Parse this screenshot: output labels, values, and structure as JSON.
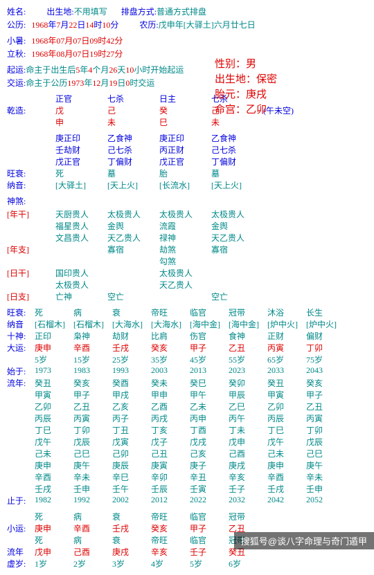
{
  "header": {
    "name_lbl": "姓名:",
    "birthplace_lbl": "出生地:",
    "birthplace": "不用填写",
    "paipan_lbl": "排盘方式:",
    "paipan": "普通方式排盘",
    "gongli_lbl": "公历:",
    "gongli_y": "1968",
    "gl_y": "年",
    "gongli_m": "7",
    "gl_m": "月",
    "gongli_d": "22",
    "gl_d": "日",
    "gongli_h": "14",
    "gl_h": "时",
    "gongli_min": "10",
    "gl_min": "分",
    "nongli_lbl": "农历:",
    "nongli": "戊申年[大驿土]六月廿七日"
  },
  "terms": {
    "xiaoshu_lbl": "小暑:",
    "xiaoshu": "1968年07月07日09时42分",
    "liqiu_lbl": "立秋:",
    "liqiu": "1968年08月07日19时27分"
  },
  "side": {
    "sex_lbl": "性别：",
    "sex": "男",
    "bp_lbl": "出生地：",
    "bp": "保密",
    "ty_lbl": "胎元：",
    "ty": "庚戌",
    "mg_lbl": "命宫：",
    "mg": "乙卯"
  },
  "qiyun": {
    "q_lbl": "起运:",
    "q_a": "命主于出生后",
    "q_y": "5",
    "q_yl": "年",
    "q_m": "4",
    "q_ml": "个月",
    "q_d": "26",
    "q_dl": "天",
    "q_h": "10",
    "q_hl": "小时开始起运",
    "j_lbl": "交运:",
    "j_a": "命主于公历",
    "j_y": "1973",
    "j_yl": "年",
    "j_m": "12",
    "j_ml": "月",
    "j_d": "19",
    "j_dl": "日",
    "j_h": "0",
    "j_hl": "时交运"
  },
  "qz": {
    "h1": [
      "正官",
      "七杀",
      "日主",
      "七杀"
    ],
    "lbl": "乾造:",
    "g": [
      "戊",
      "己",
      "癸",
      "己"
    ],
    "z": [
      "申",
      "未",
      "巳",
      "未"
    ],
    "kong": "(午未空)"
  },
  "canggan": [
    [
      "庚正印",
      "乙食神",
      "庚正印",
      "乙食神"
    ],
    [
      "壬劫财",
      "己七杀",
      "丙正财",
      "己七杀"
    ],
    [
      "戊正官",
      "丁偏财",
      "戊正官",
      "丁偏财"
    ]
  ],
  "wangshuai": {
    "lbl": "旺衰:",
    "v": [
      "死",
      "墓",
      "胎",
      "墓"
    ]
  },
  "nayin": {
    "lbl": "纳音:",
    "v": [
      "[大驿土]",
      "[天上火]",
      "[长流水]",
      "[天上火]"
    ]
  },
  "shensha": {
    "lbl": "神煞:",
    "ng_lbl": "[年干]",
    "ng": [
      [
        "天厨贵人",
        "太极贵人",
        "太极贵人",
        "太极贵人"
      ],
      [
        "福星贵人",
        "金舆",
        "流霞",
        "金舆"
      ],
      [
        "文昌贵人",
        "天乙贵人",
        "禄神",
        "天乙贵人"
      ]
    ],
    "nz_lbl": "[年支]",
    "nz": [
      [
        "",
        "寡宿",
        "劫煞",
        "寡宿"
      ],
      [
        "",
        "",
        "勾煞",
        ""
      ]
    ],
    "rg_lbl": "[日干]",
    "rg": [
      [
        "国印贵人",
        "",
        "太极贵人",
        ""
      ],
      [
        "太极贵人",
        "",
        "天乙贵人",
        ""
      ]
    ],
    "rz_lbl": "[日支]",
    "rz": [
      [
        "亡神",
        "空亡",
        "",
        "空亡"
      ]
    ]
  },
  "ws2": {
    "lbl": "旺衰:",
    "v": [
      "死",
      "病",
      "衰",
      "帝旺",
      "临官",
      "冠带",
      "沐浴",
      "长生"
    ]
  },
  "ny2": {
    "lbl": "纳音",
    "v": [
      "[石榴木]",
      "[石榴木]",
      "[大海水]",
      "[大海水]",
      "[海中金]",
      "[海中金]",
      "[炉中火]",
      "[炉中火]"
    ]
  },
  "ss2": {
    "lbl": "十神:",
    "v": [
      "正印",
      "枭神",
      "劫财",
      "比肩",
      "伤官",
      "食神",
      "正财",
      "偏财"
    ]
  },
  "dy": {
    "lbl": "大运:",
    "v": [
      "庚申",
      "辛酉",
      "壬戌",
      "癸亥",
      "甲子",
      "乙丑",
      "丙寅",
      "丁卯"
    ],
    "age": [
      "5岁",
      "15岁",
      "25岁",
      "35岁",
      "45岁",
      "55岁",
      "65岁",
      "75岁"
    ]
  },
  "syu": {
    "lbl": "始于:",
    "v": [
      "1973",
      "1983",
      "1993",
      "2003",
      "2013",
      "2023",
      "2033",
      "2043"
    ]
  },
  "ln": {
    "lbl": "流年:",
    "rows": [
      [
        "癸丑",
        "癸亥",
        "癸酉",
        "癸未",
        "癸巳",
        "癸卯",
        "癸丑",
        "癸亥"
      ],
      [
        "甲寅",
        "甲子",
        "甲戌",
        "甲申",
        "甲午",
        "甲辰",
        "甲寅",
        "甲子"
      ],
      [
        "乙卯",
        "乙丑",
        "乙亥",
        "乙酉",
        "乙未",
        "乙巳",
        "乙卯",
        "乙丑"
      ],
      [
        "丙辰",
        "丙寅",
        "丙子",
        "丙戌",
        "丙申",
        "丙午",
        "丙辰",
        "丙寅"
      ],
      [
        "丁巳",
        "丁卯",
        "丁丑",
        "丁亥",
        "丁酉",
        "丁未",
        "丁巳",
        "丁卯"
      ],
      [
        "戊午",
        "戊辰",
        "戊寅",
        "戊子",
        "戊戌",
        "戊申",
        "戊午",
        "戊辰"
      ],
      [
        "己未",
        "己巳",
        "己卯",
        "己丑",
        "己亥",
        "己酉",
        "己未",
        "己巳"
      ],
      [
        "庚申",
        "庚午",
        "庚辰",
        "庚寅",
        "庚子",
        "庚戌",
        "庚申",
        "庚午"
      ],
      [
        "辛酉",
        "辛未",
        "辛巳",
        "辛卯",
        "辛丑",
        "辛亥",
        "辛酉",
        "辛未"
      ],
      [
        "壬戌",
        "壬申",
        "壬午",
        "壬辰",
        "壬寅",
        "壬子",
        "壬戌",
        "壬申"
      ]
    ]
  },
  "zhiyu": {
    "lbl": "止于:",
    "v": [
      "1982",
      "1992",
      "2002",
      "2012",
      "2022",
      "2032",
      "2042",
      "2052"
    ]
  },
  "xy": {
    "ws": [
      "死",
      "病",
      "衰",
      "帝旺",
      "临官",
      "冠带"
    ],
    "lbl": "小运:",
    "v": [
      "庚申",
      "辛酉",
      "壬戌",
      "癸亥",
      "甲子",
      "乙丑"
    ],
    "ws2": [
      "死",
      "病",
      "衰",
      "帝旺",
      "临官",
      "冠带"
    ]
  },
  "lnn": {
    "lbl": "流年",
    "v": [
      "戊申",
      "己酉",
      "庚戌",
      "辛亥",
      "壬子",
      "癸丑"
    ]
  },
  "xs": {
    "lbl": "虚岁:",
    "v": [
      "1岁",
      "2岁",
      "3岁",
      "4岁",
      "5岁",
      "6岁"
    ]
  },
  "footer": "搜狐号@谈八字命理与奇门遁甲"
}
